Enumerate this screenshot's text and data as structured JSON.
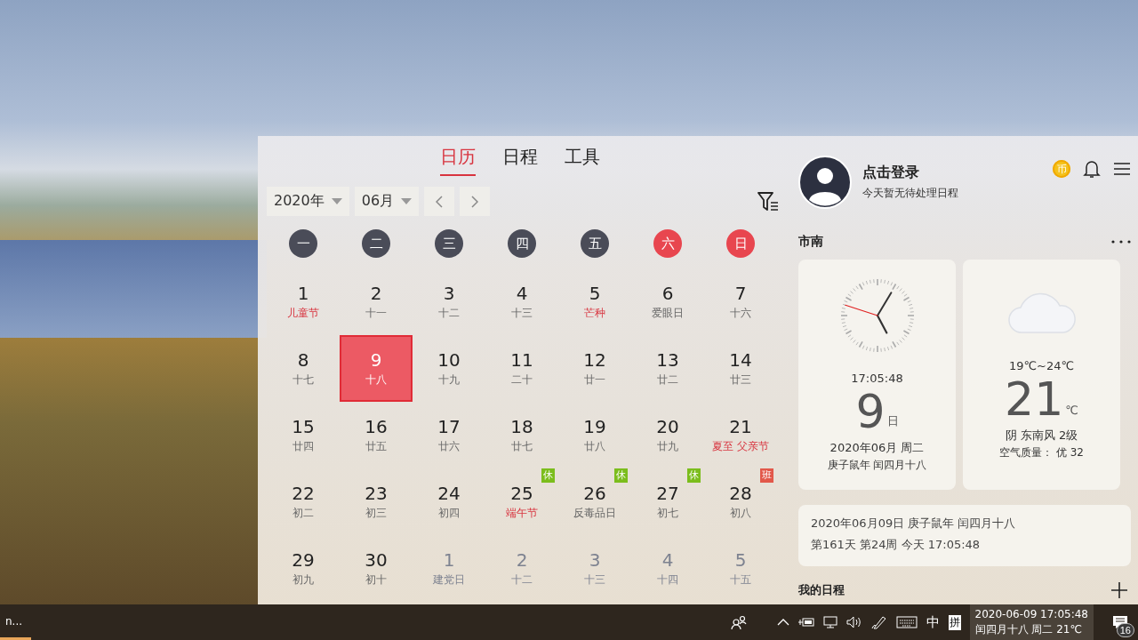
{
  "calendar": {
    "tabs": [
      {
        "label": "日历",
        "selected": true
      },
      {
        "label": "日程",
        "selected": false
      },
      {
        "label": "工具",
        "selected": false
      }
    ],
    "year": "2020年",
    "month": "06月",
    "weekdays": [
      {
        "label": "一",
        "weekend": false
      },
      {
        "label": "二",
        "weekend": false
      },
      {
        "label": "三",
        "weekend": false
      },
      {
        "label": "四",
        "weekend": false
      },
      {
        "label": "五",
        "weekend": false
      },
      {
        "label": "六",
        "weekend": true
      },
      {
        "label": "日",
        "weekend": true
      }
    ],
    "days": [
      {
        "day": "1",
        "sub": "儿童节",
        "festival": true,
        "in_month": true,
        "selected": false
      },
      {
        "day": "2",
        "sub": "十一",
        "festival": false,
        "in_month": true,
        "selected": false
      },
      {
        "day": "3",
        "sub": "十二",
        "festival": false,
        "in_month": true,
        "selected": false
      },
      {
        "day": "4",
        "sub": "十三",
        "festival": false,
        "in_month": true,
        "selected": false
      },
      {
        "day": "5",
        "sub": "芒种",
        "festival": true,
        "in_month": true,
        "selected": false
      },
      {
        "day": "6",
        "sub": "爱眼日",
        "festival": false,
        "in_month": true,
        "selected": false
      },
      {
        "day": "7",
        "sub": "十六",
        "festival": false,
        "in_month": true,
        "selected": false
      },
      {
        "day": "8",
        "sub": "十七",
        "festival": false,
        "in_month": true,
        "selected": false
      },
      {
        "day": "9",
        "sub": "十八",
        "festival": false,
        "in_month": true,
        "selected": true
      },
      {
        "day": "10",
        "sub": "十九",
        "festival": false,
        "in_month": true,
        "selected": false
      },
      {
        "day": "11",
        "sub": "二十",
        "festival": false,
        "in_month": true,
        "selected": false
      },
      {
        "day": "12",
        "sub": "廿一",
        "festival": false,
        "in_month": true,
        "selected": false
      },
      {
        "day": "13",
        "sub": "廿二",
        "festival": false,
        "in_month": true,
        "selected": false
      },
      {
        "day": "14",
        "sub": "廿三",
        "festival": false,
        "in_month": true,
        "selected": false
      },
      {
        "day": "15",
        "sub": "廿四",
        "festival": false,
        "in_month": true,
        "selected": false
      },
      {
        "day": "16",
        "sub": "廿五",
        "festival": false,
        "in_month": true,
        "selected": false
      },
      {
        "day": "17",
        "sub": "廿六",
        "festival": false,
        "in_month": true,
        "selected": false
      },
      {
        "day": "18",
        "sub": "廿七",
        "festival": false,
        "in_month": true,
        "selected": false
      },
      {
        "day": "19",
        "sub": "廿八",
        "festival": false,
        "in_month": true,
        "selected": false
      },
      {
        "day": "20",
        "sub": "廿九",
        "festival": false,
        "in_month": true,
        "selected": false
      },
      {
        "day": "21",
        "sub": "夏至 父亲节",
        "festival": true,
        "in_month": true,
        "selected": false
      },
      {
        "day": "22",
        "sub": "初二",
        "festival": false,
        "in_month": true,
        "selected": false
      },
      {
        "day": "23",
        "sub": "初三",
        "festival": false,
        "in_month": true,
        "selected": false
      },
      {
        "day": "24",
        "sub": "初四",
        "festival": false,
        "in_month": true,
        "selected": false
      },
      {
        "day": "25",
        "sub": "端午节",
        "festival": true,
        "in_month": true,
        "selected": false,
        "badge": {
          "label": "休",
          "kind": "rest"
        }
      },
      {
        "day": "26",
        "sub": "反毒品日",
        "festival": false,
        "in_month": true,
        "selected": false,
        "badge": {
          "label": "休",
          "kind": "rest"
        }
      },
      {
        "day": "27",
        "sub": "初七",
        "festival": false,
        "in_month": true,
        "selected": false,
        "badge": {
          "label": "休",
          "kind": "rest"
        }
      },
      {
        "day": "28",
        "sub": "初八",
        "festival": false,
        "in_month": true,
        "selected": false,
        "badge": {
          "label": "班",
          "kind": "work"
        }
      },
      {
        "day": "29",
        "sub": "初九",
        "festival": false,
        "in_month": true,
        "selected": false
      },
      {
        "day": "30",
        "sub": "初十",
        "festival": false,
        "in_month": true,
        "selected": false
      },
      {
        "day": "1",
        "sub": "建党日",
        "festival": false,
        "in_month": false,
        "selected": false
      },
      {
        "day": "2",
        "sub": "十二",
        "festival": false,
        "in_month": false,
        "selected": false
      },
      {
        "day": "3",
        "sub": "十三",
        "festival": false,
        "in_month": false,
        "selected": false
      },
      {
        "day": "4",
        "sub": "十四",
        "festival": false,
        "in_month": false,
        "selected": false
      },
      {
        "day": "5",
        "sub": "十五",
        "festival": false,
        "in_month": false,
        "selected": false
      }
    ]
  },
  "profile": {
    "name": "点击登录",
    "subtitle": "今天暂无待处理日程",
    "coin": "币"
  },
  "location": "市南",
  "clock_card": {
    "time": "17:05:48",
    "day": "9",
    "day_unit": "日",
    "date": "2020年06月 周二",
    "lunar": "庚子鼠年 闰四月十八"
  },
  "weather_card": {
    "range": "19℃~24℃",
    "temp": "21",
    "unit": "℃",
    "condition": "阴 东南风 2级",
    "air": "空气质量： 优 32"
  },
  "info_card": {
    "line1": "2020年06月09日 庚子鼠年 闰四月十八",
    "line2": "第161天 第24周 今天 17:05:48"
  },
  "my_schedule": "我的日程",
  "taskbar": {
    "app_label": "n...",
    "ime_mode": "中",
    "ime_layout": "拼",
    "clock_line1": "2020-06-09 17:05:48",
    "clock_line2": "闰四月十八 周二 21℃",
    "notification_count": "16"
  }
}
